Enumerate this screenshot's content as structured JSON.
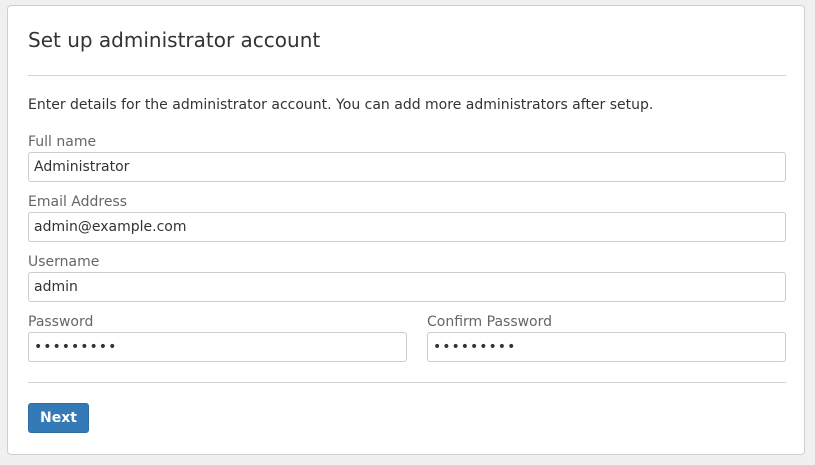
{
  "form": {
    "title": "Set up administrator account",
    "intro": "Enter details for the administrator account. You can add more administrators after setup.",
    "fields": {
      "full_name": {
        "label": "Full name",
        "value": "Administrator"
      },
      "email": {
        "label": "Email Address",
        "value": "admin@example.com"
      },
      "username": {
        "label": "Username",
        "value": "admin"
      },
      "password": {
        "label": "Password",
        "value": "123456789"
      },
      "confirm_password": {
        "label": "Confirm Password",
        "value": "123456789"
      }
    },
    "next_label": "Next"
  },
  "colors": {
    "primary": "#337ab7",
    "border": "#cccccc",
    "text": "#333333",
    "label": "#666666"
  }
}
